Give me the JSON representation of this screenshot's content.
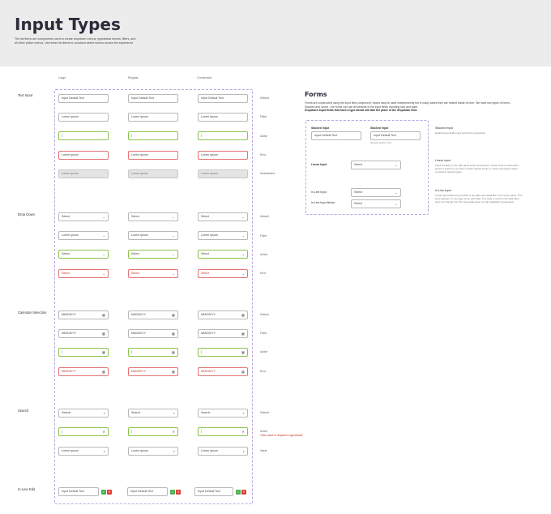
{
  "header": {
    "title": "Input Types",
    "description": "The list items are components used to create dropdown menus, typeahead menus, filters, and all other picker menus. Use these list items to construct select menus across the experience"
  },
  "columns": [
    "Large",
    "Regular",
    "Condensed"
  ],
  "sections": {
    "text_input": "Text Input",
    "drop_down": "Drop Down",
    "calendar": "Calendar Selection",
    "search": "Search",
    "inline_edit": "In-Line Edit"
  },
  "states": {
    "default": "Default",
    "filled": "Filled",
    "active": "Active",
    "error": "Error",
    "deactivated": "Deactivated",
    "search_active": "Active",
    "search_active_note": "*Also used in dropdown typeahead",
    "search_filled": "Value"
  },
  "values": {
    "placeholder": "Input Default Text",
    "filled": "Lorem ipsum",
    "cursor": "|",
    "select": "Select",
    "date": "MM/DD/YY",
    "search": "Search"
  },
  "icons": {
    "chevron": "chevron-down-icon",
    "calendar": "calendar-icon",
    "search": "search-icon",
    "clear": "close-icon",
    "confirm": "check-icon",
    "cancel": "cancel-icon"
  },
  "colors": {
    "active": "#8bc34a",
    "error": "#e57373",
    "accent_border": "#b9a6e6"
  },
  "forms": {
    "title": "Forms",
    "desc_line1": "Forms are constructed using the input field component. Inputs may be used independently but in many cases they are nested inside of form. We have two types of forms - Stacked and Linear - the forms can use all variants of the input fields including size and state.",
    "desc_line2": "Dropdown Input fields that have a type ahead will take the place of the dropdown field.",
    "stacked_label_1": "Stacked Input",
    "stacked_label_2": "Stacked Input",
    "stacked_value_1": "Input Default Text",
    "stacked_value_2": "Input Default Text",
    "helper_text": "Sample Helper Text",
    "linear_label": "Linear Input",
    "linear_value": "Select",
    "inline_label_1": "In-Line Input",
    "inline_value_1": "Select",
    "inline_label_2": "In-Line Input Below",
    "inline_value_2": "Select",
    "note_stacked_title": "Stacked Input",
    "note_stacked_body": "Default input fields used across the experience",
    "note_linear_title": "Linear Input",
    "note_linear_body": "Used primarily in the right panel where sizing does. Linear input is used when space is limited or we want to stack related inputs. In these groupings makes consistent vertical space.",
    "note_inline_title": "In-Line Input",
    "note_inline_body": "In-line Input fields are primarily in the table and detail like in the entire panel. This input appears on the page as an edit state. This style is used so the data label does not change from the view state when an edit capability is presented."
  }
}
